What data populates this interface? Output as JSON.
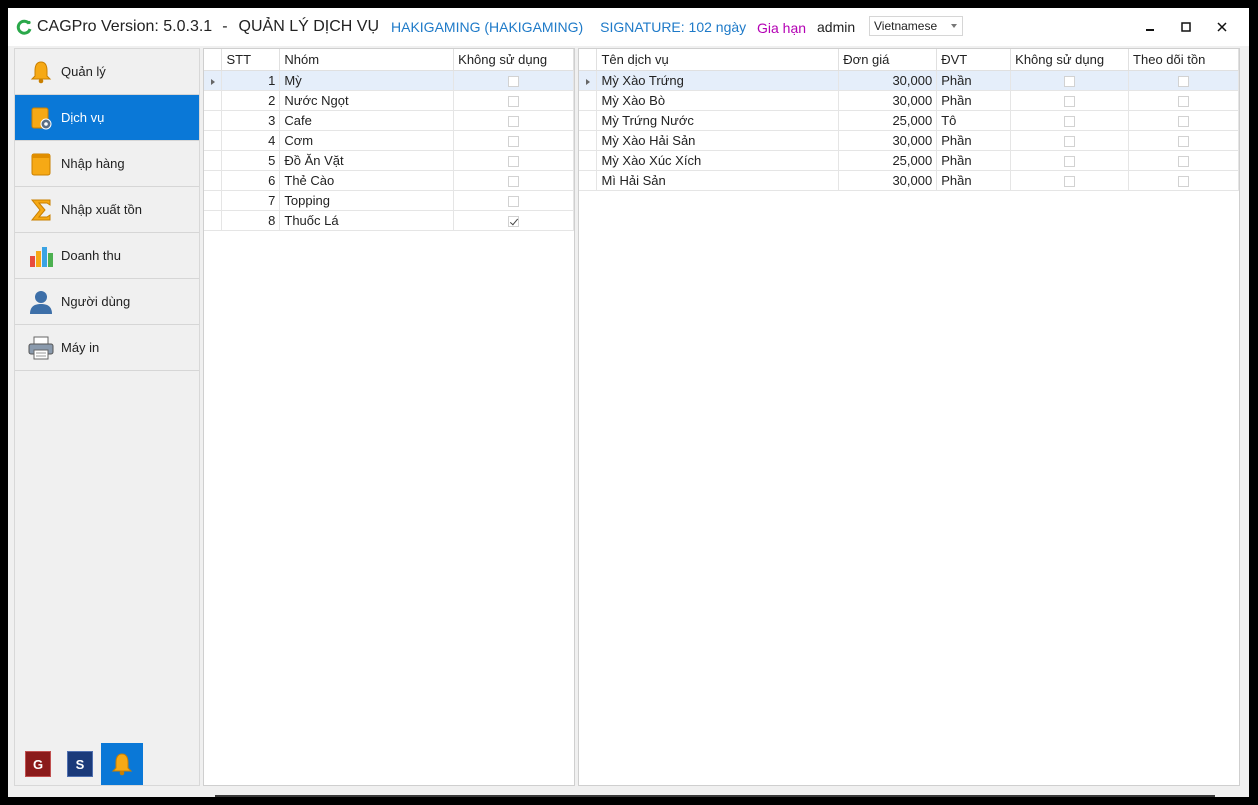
{
  "titlebar": {
    "app_title": "CAGPro Version: 5.0.3.1",
    "separator": "-",
    "module_title": "QUẢN LÝ DỊCH VỤ",
    "shop_name": "HAKIGAMING (HAKIGAMING)",
    "signature": "SIGNATURE: 102 ngày",
    "renew": "Gia hạn",
    "user": "admin",
    "language": "Vietnamese"
  },
  "colors": {
    "accent": "#0a78d7",
    "link_blue": "#1e7ac8",
    "renew_purple": "#b400b4"
  },
  "sidebar": {
    "items": [
      {
        "label": "Quản lý",
        "icon": "bell-icon",
        "active": false
      },
      {
        "label": "Dịch vụ",
        "icon": "service-gear-icon",
        "active": true
      },
      {
        "label": "Nhập hàng",
        "icon": "import-box-icon",
        "active": false
      },
      {
        "label": "Nhập xuất tồn",
        "icon": "sigma-icon",
        "active": false
      },
      {
        "label": "Doanh thu",
        "icon": "bar-chart-icon",
        "active": false
      },
      {
        "label": "Người dùng",
        "icon": "user-icon",
        "active": false
      },
      {
        "label": "Máy in",
        "icon": "printer-icon",
        "active": false
      }
    ],
    "quick": [
      {
        "label": "G",
        "icon": "g-icon"
      },
      {
        "label": "S",
        "icon": "s-icon"
      },
      {
        "label": "",
        "icon": "bell-icon"
      }
    ]
  },
  "groups": {
    "columns": [
      "STT",
      "Nhóm",
      "Không sử dụng"
    ],
    "rows": [
      {
        "stt": "1",
        "name": "Mỳ",
        "unused": false
      },
      {
        "stt": "2",
        "name": "Nước Ngọt",
        "unused": false
      },
      {
        "stt": "3",
        "name": "Cafe",
        "unused": false
      },
      {
        "stt": "4",
        "name": "Cơm",
        "unused": false
      },
      {
        "stt": "5",
        "name": "Đồ Ăn Vặt",
        "unused": false
      },
      {
        "stt": "6",
        "name": "Thẻ Cào",
        "unused": false
      },
      {
        "stt": "7",
        "name": "Topping",
        "unused": false
      },
      {
        "stt": "8",
        "name": "Thuốc Lá",
        "unused": true
      }
    ]
  },
  "services": {
    "columns": [
      "Tên dịch vụ",
      "Đơn giá",
      "ĐVT",
      "Không sử dụng",
      "Theo dõi tồn"
    ],
    "rows": [
      {
        "name": "Mỳ Xào Trứng",
        "price": "30,000",
        "unit": "Phần",
        "unused": false,
        "track": false
      },
      {
        "name": "Mỳ Xào Bò",
        "price": "30,000",
        "unit": "Phần",
        "unused": false,
        "track": false
      },
      {
        "name": "Mỳ Trứng Nước",
        "price": "25,000",
        "unit": "Tô",
        "unused": false,
        "track": false
      },
      {
        "name": "Mỳ Xào Hải Sản",
        "price": "30,000",
        "unit": "Phần",
        "unused": false,
        "track": false
      },
      {
        "name": "Mỳ Xào Xúc Xích",
        "price": "25,000",
        "unit": "Phần",
        "unused": false,
        "track": false
      },
      {
        "name": "Mì Hải Sản",
        "price": "30,000",
        "unit": "Phần",
        "unused": false,
        "track": false
      }
    ]
  }
}
